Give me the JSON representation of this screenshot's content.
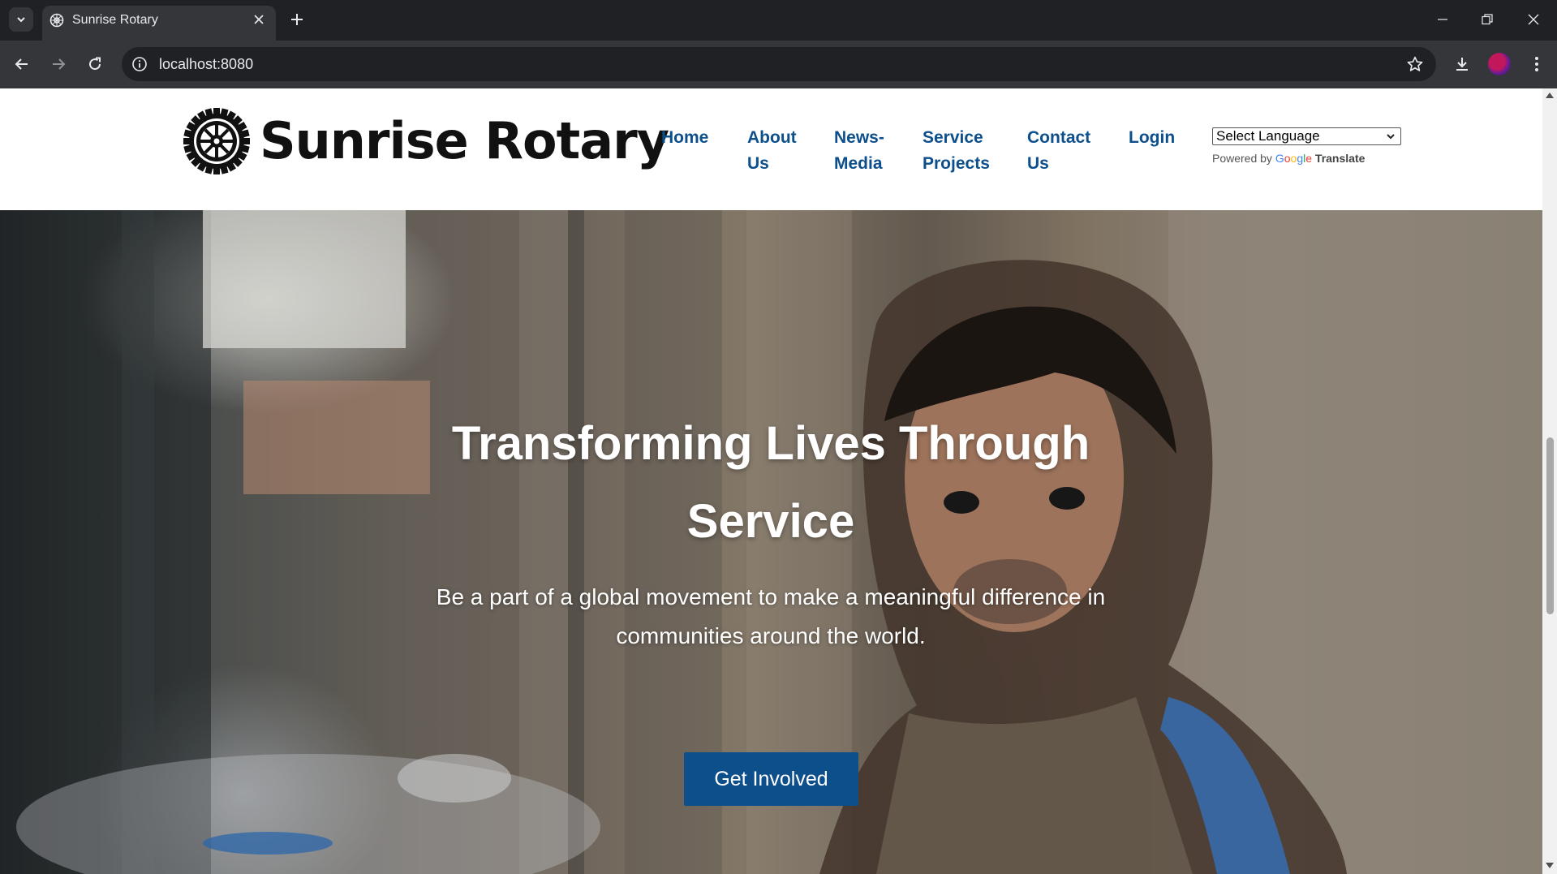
{
  "browser": {
    "tab": {
      "title": "Sunrise Rotary",
      "favicon": "rotary-wheel-icon"
    },
    "address_bar": {
      "url": "localhost:8080"
    },
    "icons": {
      "tab_list": "chevron-down-icon",
      "new_tab": "plus-icon",
      "back": "arrow-left-icon",
      "forward": "arrow-right-icon",
      "reload": "reload-icon",
      "site_info": "info-icon",
      "bookmark": "star-icon",
      "download": "download-icon",
      "menu": "kebab-menu-icon"
    }
  },
  "site": {
    "logo_text": "Sunrise Rotary",
    "nav": [
      {
        "label_lines": [
          "Home"
        ]
      },
      {
        "label_lines": [
          "About",
          "Us"
        ]
      },
      {
        "label_lines": [
          "News-",
          "Media"
        ]
      },
      {
        "label_lines": [
          "Service",
          "Projects"
        ]
      },
      {
        "label_lines": [
          "Contact",
          "Us"
        ]
      },
      {
        "label_lines": [
          "Login"
        ]
      }
    ],
    "translate": {
      "select_value": "Select Language",
      "powered_by": "Powered by",
      "google": "Google",
      "translate": "Translate"
    }
  },
  "hero": {
    "title_line1": "Transforming Lives Through",
    "title_line2": "Service",
    "subtitle_line1": "Be a part of a global movement to make a meaningful difference in",
    "subtitle_line2": "communities around the world.",
    "cta": "Get Involved"
  },
  "colors": {
    "brand_blue": "#0d4f8b",
    "chrome_dark": "#202124",
    "chrome_mid": "#35363a"
  }
}
